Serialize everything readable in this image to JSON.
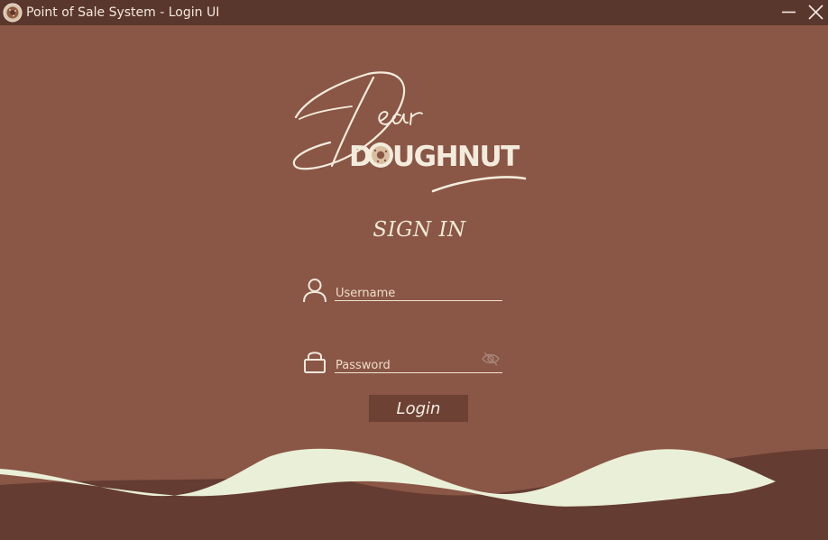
{
  "window": {
    "title": "Point of Sale System - Login UI",
    "icon": "doughnut-icon",
    "controls": [
      "minimize-icon",
      "close-icon"
    ]
  },
  "logo": {
    "script_text": "Dear",
    "brand_text": "DOUGHNUT"
  },
  "form": {
    "heading": "SIGN IN",
    "username": {
      "placeholder": "Username",
      "value": "",
      "icon": "user-icon"
    },
    "password": {
      "placeholder": "Password",
      "value": "",
      "icon": "lock-icon",
      "toggle_icon": "eye-slash-icon"
    },
    "submit_label": "Login"
  },
  "colors": {
    "background": "#8a5646",
    "titlebar": "#5a372c",
    "cream": "#eaefd7",
    "dark_wave": "#643c31",
    "button": "#6d4133"
  }
}
